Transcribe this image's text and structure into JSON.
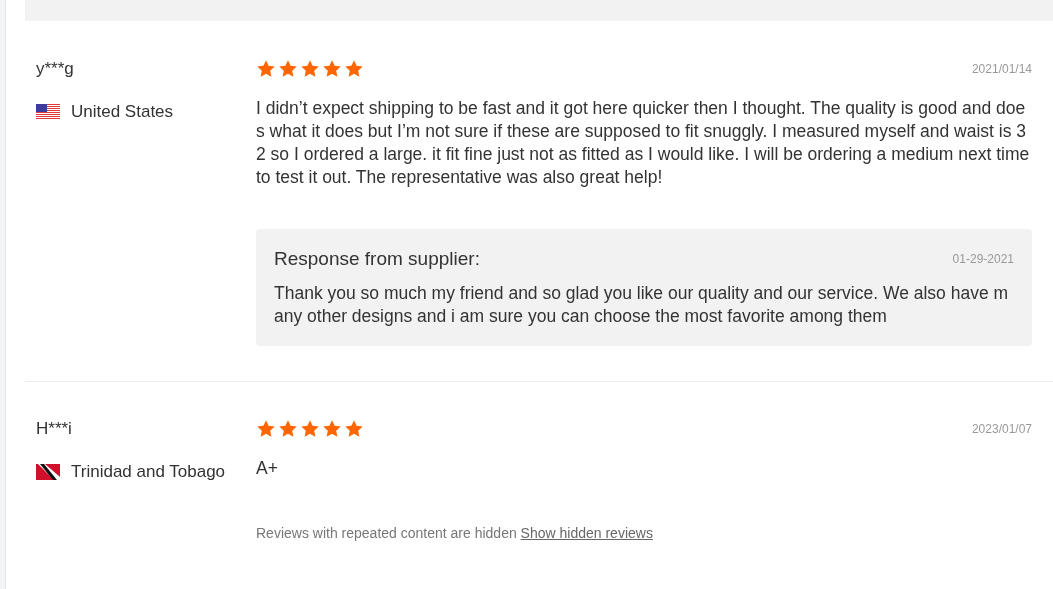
{
  "reviews": [
    {
      "user": "y***g",
      "kind": "us",
      "country": "United States",
      "stars": 5,
      "date": "2021/01/14",
      "text": "I didn’t expect shipping to be fast and it got here quicker then I thought. The quality is good and does what it does but I’m not sure if these are supposed to fit snuggly. I measured myself and waist is 32 so I ordered a large. it fit fine just not as fitted as I would like. I will be ordering a medium next time to test it out. The representative was also great help!",
      "response": {
        "title": "Response from supplier:",
        "date": "01-29-2021",
        "text": "Thank you so much my friend and so glad you like our quality and our service. We also have many other designs and i am sure you can choose the most favorite among them"
      }
    },
    {
      "user": "H***i",
      "kind": "tt",
      "country": "Trinidad and Tobago",
      "stars": 5,
      "date": "2023/01/07",
      "text": "A+"
    }
  ],
  "hidden_note": {
    "text": "Reviews with repeated content are hidden",
    "link": "Show hidden reviews"
  }
}
